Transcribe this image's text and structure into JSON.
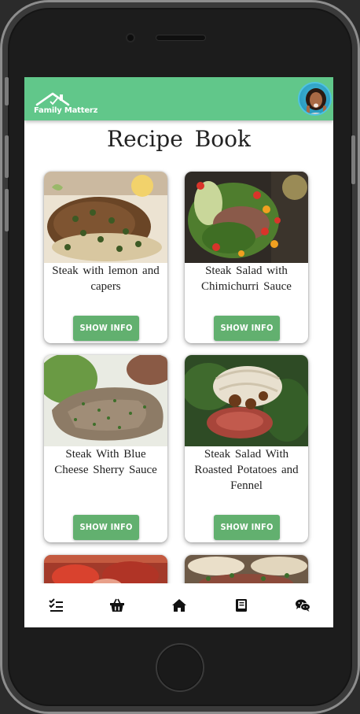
{
  "app": {
    "logo_text": "Family Matterz",
    "header_color": "#61c78a"
  },
  "page": {
    "title": "Recipe Book"
  },
  "recipes": [
    {
      "title": "Steak with lemon and capers",
      "button_label": "SHOW INFO"
    },
    {
      "title": "Steak Salad with Chimichurri Sauce",
      "button_label": "SHOW INFO"
    },
    {
      "title": "Steak With Blue Cheese Sherry Sauce",
      "button_label": "SHOW INFO"
    },
    {
      "title": "Steak Salad With Roasted Potatoes and Fennel",
      "button_label": "SHOW INFO"
    }
  ],
  "bottom_nav": [
    {
      "icon": "checklist-icon"
    },
    {
      "icon": "basket-icon"
    },
    {
      "icon": "home-icon"
    },
    {
      "icon": "book-icon"
    },
    {
      "icon": "chat-icon"
    }
  ],
  "colors": {
    "accent": "#61c78a",
    "button": "#62b06f"
  }
}
